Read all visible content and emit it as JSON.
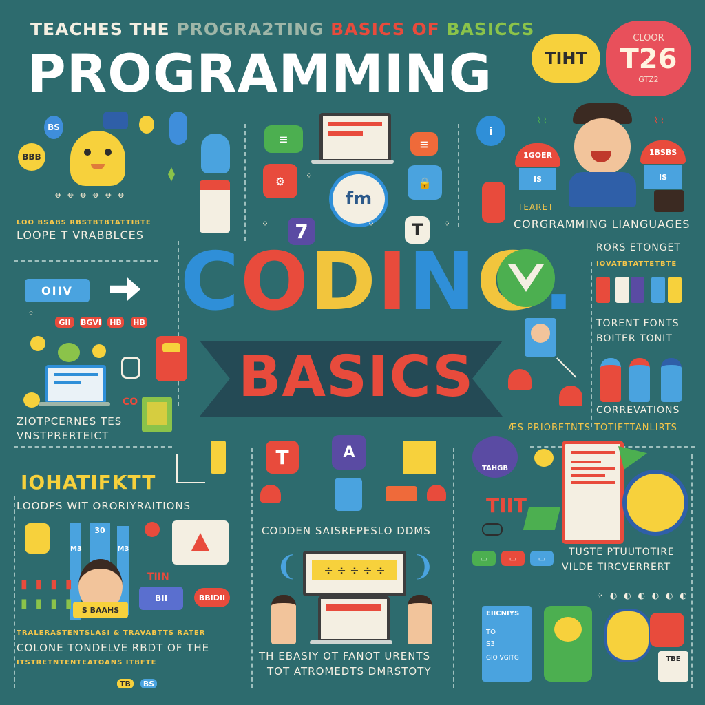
{
  "header": {
    "line1_part1": "TEACHES THE",
    "line1_part2": "PROGRA2TING",
    "line1_part3": "BASICS OF",
    "line1_part4": "BASICCS",
    "title": "PROGRAMMING",
    "badge_yellow": "TIHT",
    "badge_red_top": "CLOOR",
    "badge_red_main": "T26",
    "badge_red_bottom": "GTZ2"
  },
  "center": {
    "coding_letters": [
      "C",
      "O",
      "D",
      "I",
      "N",
      "G",
      "."
    ],
    "coding_colors": [
      "#2f8fd8",
      "#e84b3c",
      "#f2c53d",
      "#e84b3c",
      "#2f8fd8",
      "#f2c53d",
      "#2f8fd8"
    ],
    "basics": "BASICS",
    "center_badge": "fm"
  },
  "left": {
    "caption1_small": "LOO BSABS RBSTBTBTATTIBTE",
    "caption1": "LOOPE T VRABBLCES",
    "oiiv": "OIIV",
    "chips": [
      "GII",
      "BGVI",
      "HB",
      "HB"
    ],
    "caption2": "ZIOTPCERNES TES",
    "caption3": "VNSTPRERTEICT",
    "co_text": "CO",
    "heading_colored": "IOHATIFKTT",
    "caption4": "LOODPS WIT ORORIYRAITIONS",
    "bar_labels": [
      "30",
      "M3",
      "M3"
    ],
    "face_tag": "S BAAHS",
    "chip_blue": "BII",
    "chip_red": "BBIDII",
    "tiin": "TIIN",
    "caption5_small": "TRALERASTENTSLASI & TRAVABTTS RATER",
    "caption5": "COLONE TONDELVE RBDT OF THE",
    "caption6_small": "ITSTRETNTENTEATOANS ITBFTE",
    "bottom_tags": [
      "TB",
      "BS"
    ]
  },
  "middle": {
    "caption_middle": "CODDEN SAISREPESLO DDMS",
    "formula": "÷ ÷ ÷ ÷ ÷",
    "caption_bottom1": "TH EBASIY OT FANOT URENTS",
    "caption_bottom2": "TOT ATROMEDTS DMRSTOTY",
    "tile_t": "T",
    "tile_7": "7",
    "tile_a": "A"
  },
  "right": {
    "candy_left": "1GOER",
    "candy_left_small": "IS",
    "candy_right": "1BSBS",
    "candy_right_small": "IS",
    "caption_teaset": "TEARET",
    "caption1": "CORGRAMMING LIANGUAGES",
    "caption2": "RORS ETONGET",
    "caption2_small": "IOVATBTATTETBTE",
    "caption3": "TORENT FONTS",
    "caption4": "BOITER TONIT",
    "caption5": "CORREVATIONS",
    "caption6": "ÆS PRIOBETNTS TOTIETTANLIRTS",
    "bubble_label": "TAHGB",
    "tiit": "TIIT",
    "caption7": "TUSTE PTUUTOTIRE",
    "caption8": "VILDE TIRCVERRERT",
    "panel_title": "EIICNIYS",
    "panel_line1": "TO",
    "panel_line2": "S3",
    "panel_line3": "GIO VGITG",
    "tbe": "TBE"
  }
}
